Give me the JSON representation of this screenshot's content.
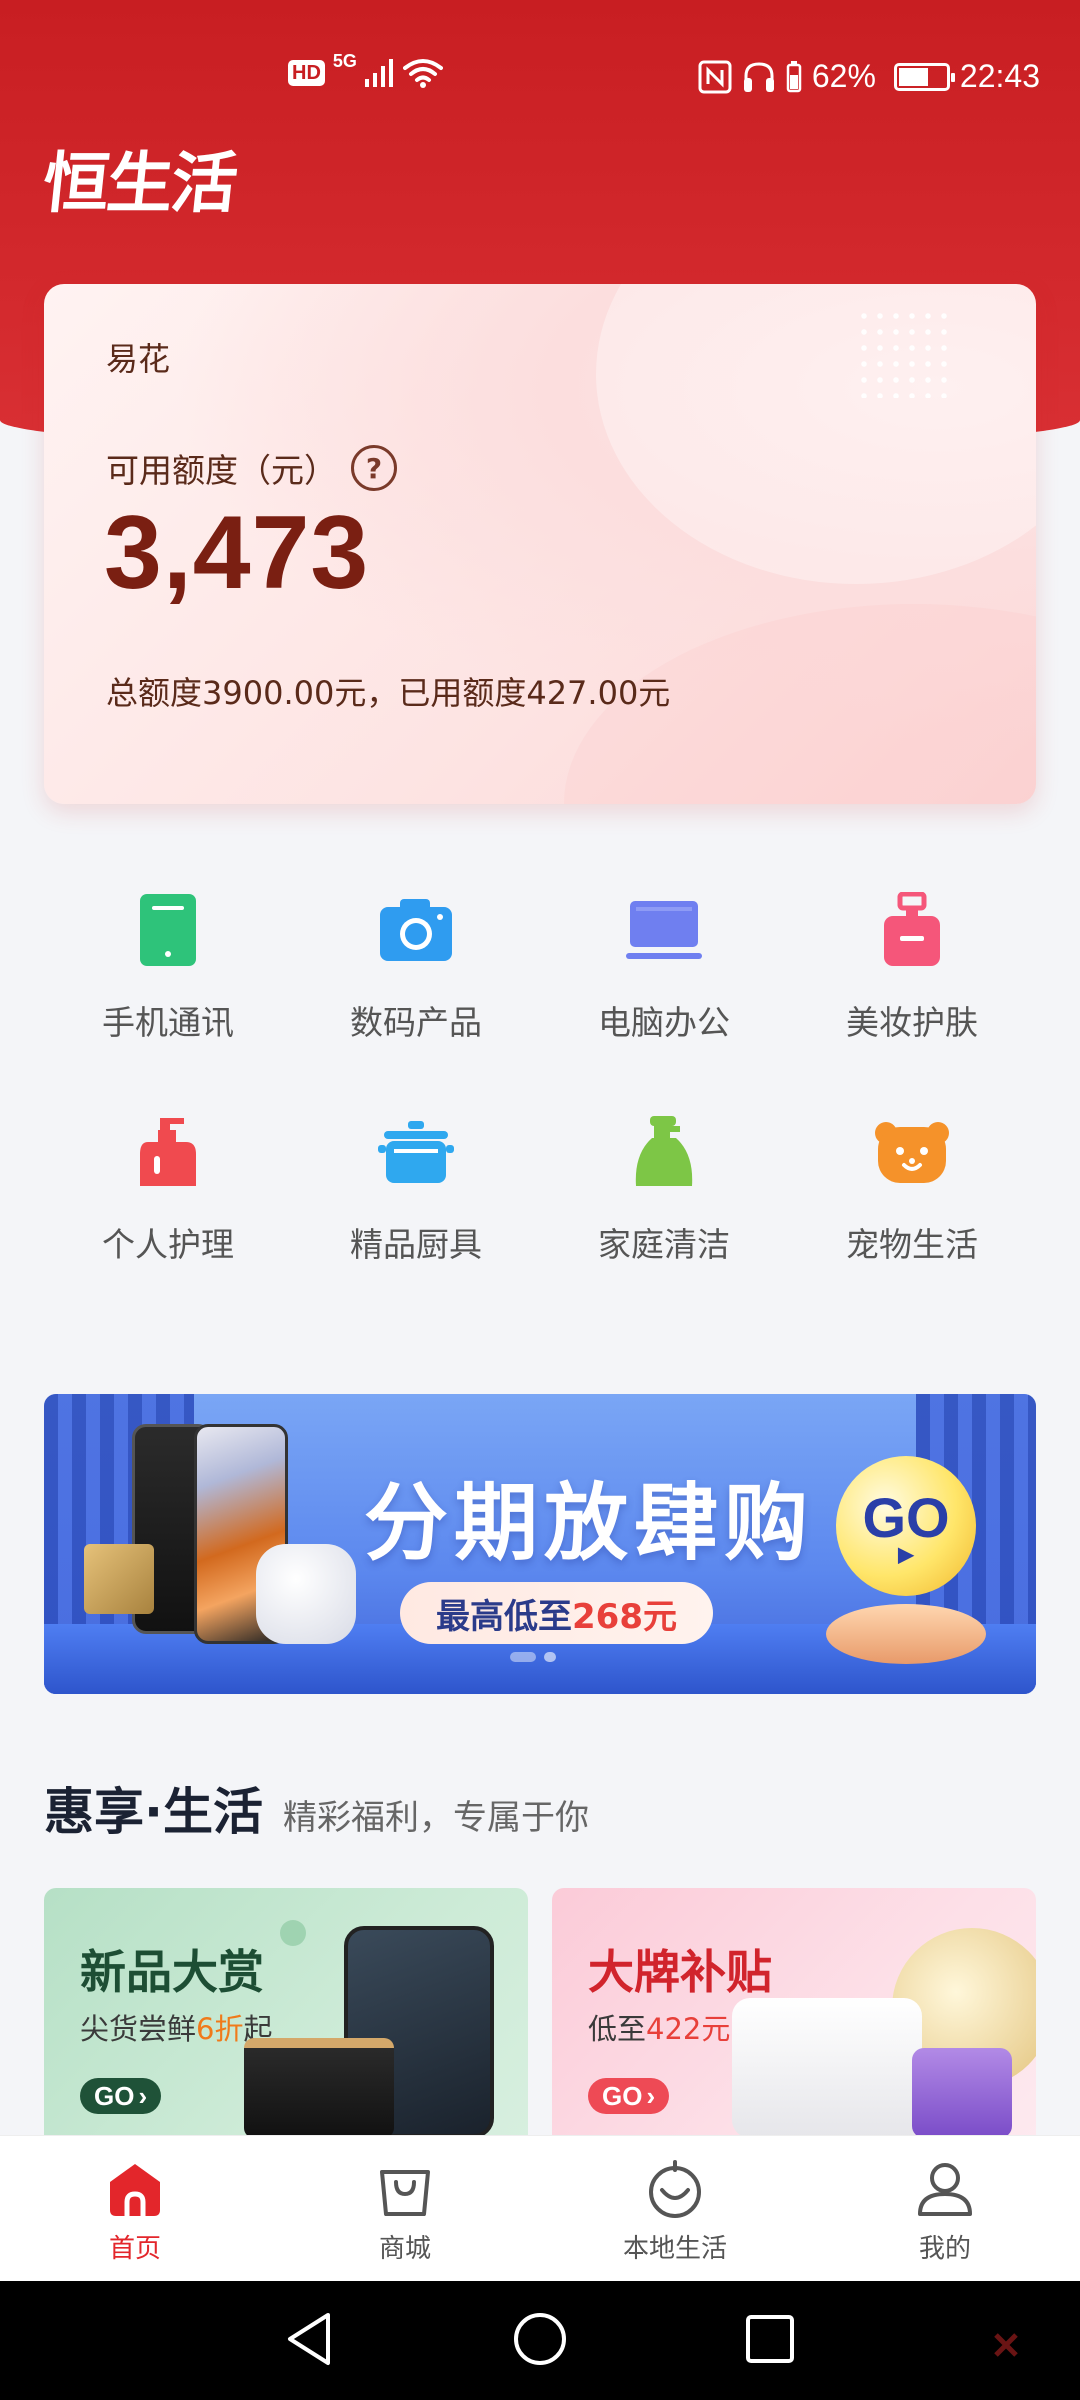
{
  "status_bar": {
    "hd": "HD",
    "network": "5G",
    "battery_pct_text": "62%",
    "battery_level": 0.62,
    "time": "22:43"
  },
  "app": {
    "logo_text": "恒生活"
  },
  "credit_card": {
    "product_name": "易花",
    "available_label": "可用额度（元）",
    "available_amount": "3,473",
    "summary": "总额度3900.00元，已用额度427.00元"
  },
  "categories": [
    {
      "label": "手机通讯",
      "icon": "phone-icon",
      "color": "#2ec37a"
    },
    {
      "label": "数码产品",
      "icon": "camera-icon",
      "color": "#2f9cf0"
    },
    {
      "label": "电脑办公",
      "icon": "laptop-icon",
      "color": "#6f7ff0"
    },
    {
      "label": "美妆护肤",
      "icon": "perfume-icon",
      "color": "#f5567a"
    },
    {
      "label": "个人护理",
      "icon": "lotion-bottle-icon",
      "color": "#f04a4f"
    },
    {
      "label": "精品厨具",
      "icon": "cooking-pot-icon",
      "color": "#2fa8ef"
    },
    {
      "label": "家庭清洁",
      "icon": "detergent-icon",
      "color": "#7dc646"
    },
    {
      "label": "宠物生活",
      "icon": "pet-bear-icon",
      "color": "#f5922a"
    }
  ],
  "banner": {
    "title": "分期放肆购",
    "sub_prefix": "最高低至",
    "sub_highlight": "268元",
    "go_label": "GO",
    "page_count": 2,
    "active_page": 0
  },
  "section": {
    "title": "惠享·生活",
    "subtitle": "精彩福利，专属于你"
  },
  "promos": [
    {
      "title": "新品大赏",
      "sub_prefix": "尖货尝鲜",
      "sub_highlight": "6折",
      "sub_suffix": "起",
      "go_label": "GO"
    },
    {
      "title": "大牌补贴",
      "sub_prefix": "低至",
      "sub_highlight": "422元",
      "sub_suffix": "",
      "go_label": "GO"
    }
  ],
  "bottom_nav": [
    {
      "label": "首页",
      "icon": "home-icon",
      "active": true
    },
    {
      "label": "商城",
      "icon": "shopping-bag-icon",
      "active": false
    },
    {
      "label": "本地生活",
      "icon": "local-life-icon",
      "active": false
    },
    {
      "label": "我的",
      "icon": "profile-icon",
      "active": false
    }
  ],
  "colors": {
    "brand_red": "#d42a2e",
    "amount_brown": "#7a1f12",
    "nav_active": "#e3262b"
  }
}
